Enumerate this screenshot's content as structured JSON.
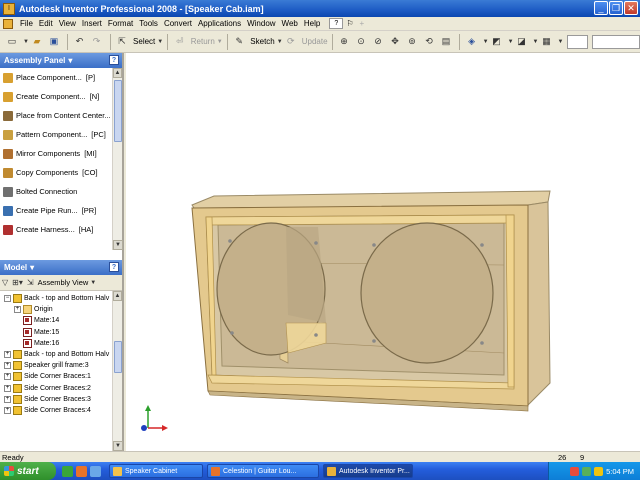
{
  "window": {
    "title": "Autodesk Inventor Professional 2008 - [Speaker Cab.iam]",
    "buttons": [
      "_",
      "❐",
      "✕"
    ]
  },
  "menu": {
    "items": [
      "File",
      "Edit",
      "View",
      "Insert",
      "Format",
      "Tools",
      "Convert",
      "Applications",
      "Window",
      "Web",
      "Help"
    ]
  },
  "toolbar": {
    "select_label": "Select",
    "return_label": "Return",
    "sketch_label": "Sketch",
    "update_label": "Update"
  },
  "assembly_panel": {
    "title": "Assembly Panel",
    "items": [
      {
        "label": "Place Component...",
        "shortcut": "[P]",
        "icon_color": "#d8a030"
      },
      {
        "label": "Create Component...",
        "shortcut": "[N]",
        "icon_color": "#d8a030"
      },
      {
        "label": "Place from Content Center...",
        "shortcut": "",
        "icon_color": "#8a6a3a"
      },
      {
        "label": "Pattern Component...",
        "shortcut": "[PC]",
        "icon_color": "#c9a040"
      },
      {
        "label": "Mirror Components",
        "shortcut": "[MI]",
        "icon_color": "#b07030"
      },
      {
        "label": "Copy Components",
        "shortcut": "[CO]",
        "icon_color": "#c08a30"
      },
      {
        "label": "Bolted Connection",
        "shortcut": "",
        "icon_color": "#707070"
      },
      {
        "label": "Create Pipe Run...",
        "shortcut": "[PR]",
        "icon_color": "#3a70b0"
      },
      {
        "label": "Create Harness...",
        "shortcut": "[HA]",
        "icon_color": "#b03030"
      }
    ]
  },
  "model_panel": {
    "title": "Model",
    "view_label": "Assembly View",
    "tree": [
      {
        "label": "Back - top and Bottom Halv",
        "type": "part",
        "indent": 0,
        "exp": "−"
      },
      {
        "label": "Origin",
        "type": "folder",
        "indent": 1,
        "exp": "+"
      },
      {
        "label": "Mate:14",
        "type": "mate",
        "indent": 1,
        "exp": ""
      },
      {
        "label": "Mate:15",
        "type": "mate",
        "indent": 1,
        "exp": ""
      },
      {
        "label": "Mate:16",
        "type": "mate",
        "indent": 1,
        "exp": ""
      },
      {
        "label": "Back - top and Bottom Halv",
        "type": "part",
        "indent": 0,
        "exp": "+"
      },
      {
        "label": "Speaker grill frame:3",
        "type": "part",
        "indent": 0,
        "exp": "+"
      },
      {
        "label": "Side Corner Braces:1",
        "type": "part",
        "indent": 0,
        "exp": "+"
      },
      {
        "label": "Side Corner Braces:2",
        "type": "part",
        "indent": 0,
        "exp": "+"
      },
      {
        "label": "Side Corner Braces:3",
        "type": "part",
        "indent": 0,
        "exp": "+"
      },
      {
        "label": "Side Corner Braces:4",
        "type": "part",
        "indent": 0,
        "exp": "+"
      }
    ]
  },
  "status": {
    "text": "Ready",
    "count_a": "26",
    "count_b": "9"
  },
  "taskbar": {
    "start_label": "start",
    "tasks": [
      {
        "label": "Speaker Cabinet",
        "icon_color": "#f3c24a",
        "active": false
      },
      {
        "label": "Celestion | Guitar Lou...",
        "icon_color": "#e8732a",
        "active": false
      },
      {
        "label": "Autodesk Inventor Pr...",
        "icon_color": "#e9b23a",
        "active": true
      }
    ],
    "clock": "5:04 PM"
  }
}
